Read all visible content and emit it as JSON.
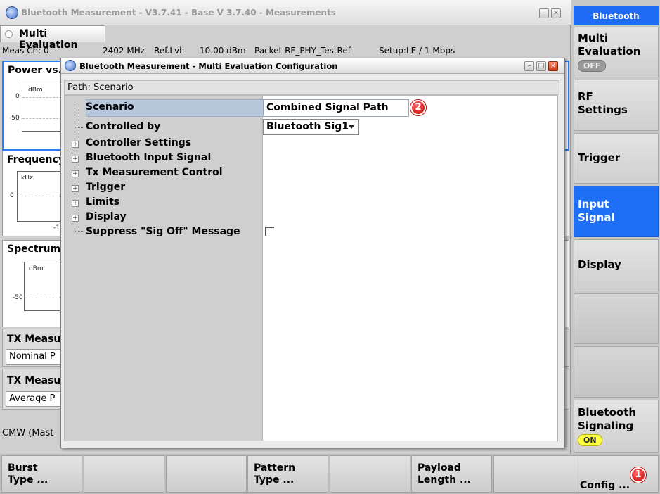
{
  "window": {
    "title": "Bluetooth Measurement  - V3.7.41 - Base V 3.7.40 - Measurements"
  },
  "tab": {
    "label": "Multi Evaluation"
  },
  "info_row": {
    "meas_ch": "Meas Ch: 0",
    "freq_value": "2402 MHz",
    "ref_lvl_label": "Ref.Lvl:",
    "ref_lvl_value": "10.00 dBm",
    "packet": "Packet RF_PHY_TestRef",
    "setup": "Setup:LE / 1 Mbps"
  },
  "panels": {
    "power": {
      "title": "Power vs.",
      "unit": "dBm",
      "tick_top": "0",
      "tick_bottom": "-50"
    },
    "frequency": {
      "title": "Frequency",
      "unit": "kHz",
      "tick_mid": "0",
      "tick_bottom_right": "-1"
    },
    "spectrum": {
      "title": "Spectrum",
      "unit": "dBm",
      "tick_bottom": "-50"
    },
    "tx_meas_1": {
      "title": "TX Measu",
      "field": "Nominal P"
    },
    "tx_meas_2": {
      "title": "TX Measu",
      "field": "Average P"
    },
    "status": "CMW (Mast"
  },
  "dialog": {
    "title": "Bluetooth Measurement  - Multi Evaluation Configuration",
    "path_label": "Path:",
    "path_value": "Scenario",
    "tree": {
      "scenario": "Scenario",
      "controlled_by": "Controlled by",
      "controller_settings": "Controller Settings",
      "bluetooth_input_signal": "Bluetooth Input Signal",
      "tx_measurement_control": "Tx Measurement Control",
      "trigger": "Trigger",
      "limits": "Limits",
      "display": "Display",
      "suppress": "Suppress \"Sig Off\" Message"
    },
    "values": {
      "scenario": "Combined Signal Path",
      "controlled_by": "Bluetooth Sig1",
      "suppress_checked": false
    }
  },
  "badges": {
    "one": "1",
    "two": "2"
  },
  "right_panel": {
    "header": "Bluetooth",
    "multi_evaluation": "Multi\nEvaluation",
    "multi_evaluation_state": "OFF",
    "rf_settings": "RF\nSettings",
    "trigger": "Trigger",
    "input_signal": "Input\nSignal",
    "display": "Display",
    "bluetooth_signaling": "Bluetooth\nSignaling",
    "bluetooth_signaling_state": "ON",
    "config": "Config ..."
  },
  "bottom_bar": {
    "burst_type": "Burst\nType ...",
    "pattern_type": "Pattern\nType ...",
    "payload_length": "Payload\nLength ..."
  },
  "colors": {
    "accent_blue": "#1e6ff5",
    "badge_red": "#c40000",
    "on_yellow": "#ffff44"
  }
}
